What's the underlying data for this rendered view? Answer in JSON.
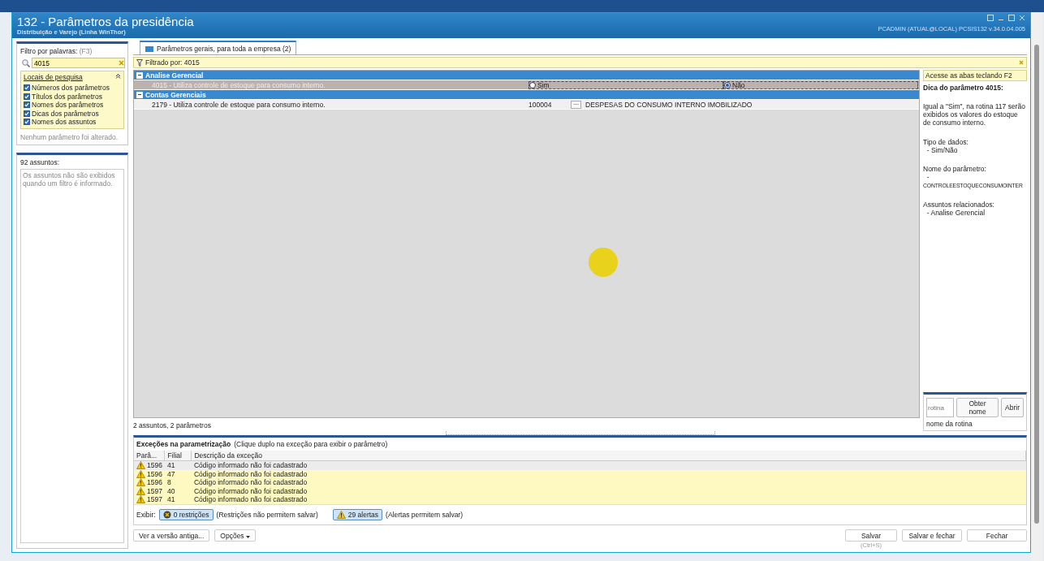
{
  "window": {
    "title": "132 - Parâmetros da presidência",
    "subtitle": "Distribuição e Varejo (Linha WinThor)",
    "user_info": "PCADMIN (ATUAL@LOCAL)   PCSIS132  v.34.0.04.005"
  },
  "filter": {
    "label": "Filtro por palavras:",
    "shortcut": "(F3)",
    "value": "4015",
    "places_title": "Locais de pesquisa",
    "expanded": true,
    "options": [
      {
        "label": "Números dos parâmetros",
        "checked": true
      },
      {
        "label": "Títulos dos parâmetros",
        "checked": true
      },
      {
        "label": "Nomes dos parâmetros",
        "checked": true
      },
      {
        "label": "Dicas dos parâmetros",
        "checked": true
      },
      {
        "label": "Nomes dos assuntos",
        "checked": true
      }
    ],
    "status": "Nenhum parâmetro foi alterado."
  },
  "subjects": {
    "count": "92 assuntos:",
    "note": "Os assuntos não são exibidos quando um filtro é informado."
  },
  "tabs": [
    {
      "label": "Parâmetros gerais, para toda a empresa  (2)",
      "selected": true
    }
  ],
  "filter_bar": {
    "text": "Filtrado por: 4015"
  },
  "groups": [
    {
      "title": "Analise Gerencial",
      "expanded": true,
      "rows": [
        {
          "kind": "radio",
          "label": "4015 - Utiliza controle de estoque para consumo interno.",
          "selected": true,
          "options": [
            {
              "label": "Sim",
              "selected": false
            },
            {
              "label": "Não",
              "selected": true
            }
          ]
        }
      ]
    },
    {
      "title": "Contas Gerenciais",
      "expanded": true,
      "rows": [
        {
          "kind": "lookup",
          "label": "2179 - Utiliza controle de estoque para consumo interno.",
          "selected": false,
          "code": "100004",
          "button": "···",
          "description": "DESPESAS DO CONSUMO INTERNO IMOBILIZADO"
        }
      ]
    }
  ],
  "grid_status": "2 assuntos, 2 parâmetros",
  "hint_panel": {
    "tab_hint": "Acesse as abas teclando F2",
    "title": "Dica do parâmetro 4015:",
    "description": "Igual a \"Sim\", na rotina 117 serão exibidos os valores do estoque de consumo interno.",
    "data_type_label": "Tipo de dados:",
    "data_type": "- Sim/Não",
    "name_label": "Nome do parâmetro:",
    "name_dash": "-",
    "name": "CONTROLEESTOQUECONSUMOINTER",
    "related_label": "Assuntos relacionados:",
    "related": [
      "- Analise Gerencial"
    ]
  },
  "routine": {
    "placeholder": "rotina",
    "buttons": [
      "Obter nome",
      "Abrir"
    ],
    "name": "nome da rotina"
  },
  "exceptions": {
    "title": "Exceções na parametrização",
    "hint": "(Clique duplo na exceção para exibir o parâmetro)",
    "columns": [
      "Parâ...",
      "Filial",
      "Descrição da exceção"
    ],
    "rows": [
      {
        "param": "1596",
        "branch": "41",
        "description": "Código informado não foi cadastrado",
        "selected": true
      },
      {
        "param": "1596",
        "branch": "47",
        "description": "Código informado não foi cadastrado",
        "selected": false
      },
      {
        "param": "1596",
        "branch": "8",
        "description": "Código informado não foi cadastrado",
        "selected": false
      },
      {
        "param": "1597",
        "branch": "40",
        "description": "Código informado não foi cadastrado",
        "selected": false
      },
      {
        "param": "1597",
        "branch": "41",
        "description": "Código informado não foi cadastrado",
        "selected": false
      }
    ],
    "show_label": "Exibir:",
    "toggles": [
      {
        "kind": "restriction",
        "label": "0 restrições",
        "note": "(Restrições não permitem salvar)",
        "pressed": true
      },
      {
        "kind": "alert",
        "label": "29 alertas",
        "note": "(Alertas permitem salvar)",
        "pressed": true
      }
    ]
  },
  "footer": {
    "old_version": "Ver a versão antiga...",
    "options": "Opções",
    "save": "Salvar",
    "save_shortcut": "(Ctrl+S)",
    "save_close": "Salvar e fechar",
    "close": "Fechar"
  }
}
